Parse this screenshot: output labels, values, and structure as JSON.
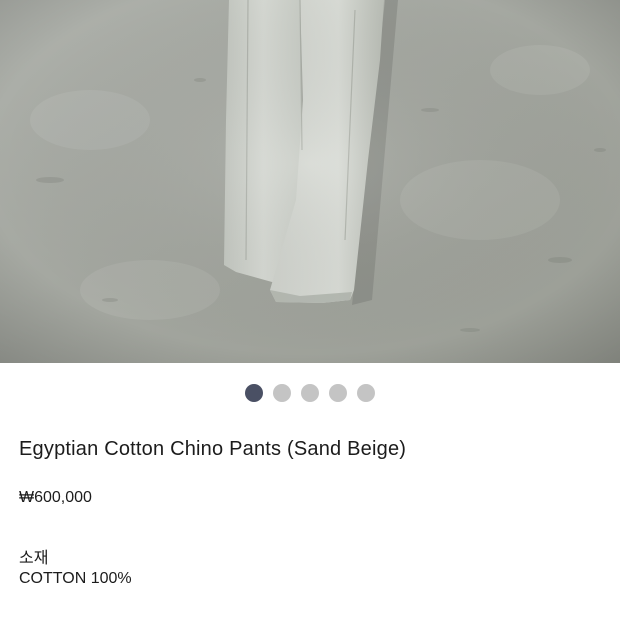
{
  "product": {
    "image_alt": "product-photo-pants-hanging",
    "carousel": {
      "count": 5,
      "active_index": 0
    },
    "title": "Egyptian Cotton Chino Pants (Sand Beige)",
    "price": "₩600,000",
    "material_label": "소재",
    "material_value": "COTTON 100%"
  },
  "colors": {
    "dot_active": "#4a5064",
    "dot_inactive": "#c4c4c4"
  }
}
